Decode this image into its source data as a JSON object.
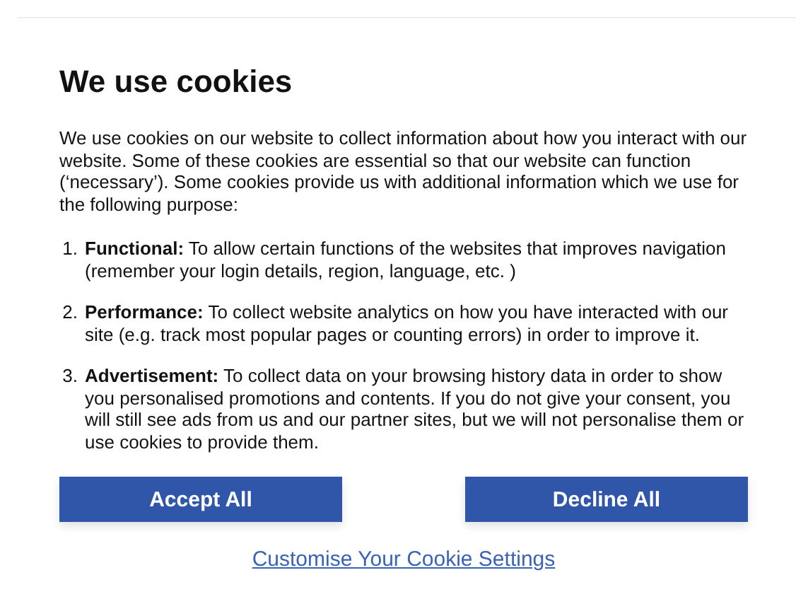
{
  "title": "We use cookies",
  "intro": "We use cookies on our website to collect information about how you interact with our website. Some of these cookies are essential so that our website can function (‘necessary’). Some cookies provide us with additional information which we use for the following purpose:",
  "purposes": [
    {
      "number": "1.",
      "text": "**Functional:** To allow certain functions of the websites that improves navigation (remember your login details, region, language, etc. )"
    },
    {
      "number": "2.",
      "text": "**Performance:** To collect website analytics on how you have interacted with our site (e.g. track most popular pages or counting errors) in order to improve it."
    },
    {
      "number": "3.",
      "text": "**Advertisement:** To collect data on your browsing history data in order to show you personalised promotions and contents. If you do not give your consent, you will still see ads from us and our partner sites, but we will not personalise them or use cookies to provide them."
    }
  ],
  "buttons": [
    "Accept All",
    "Decline All"
  ],
  "settings_link": "Customise Your Cookie Settings"
}
